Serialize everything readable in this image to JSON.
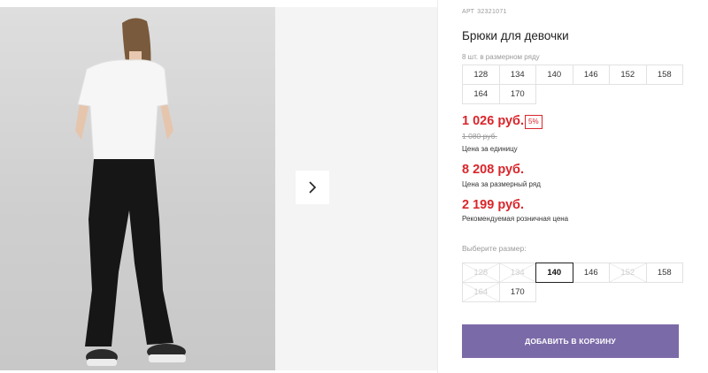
{
  "product": {
    "article_label": "АРТ",
    "article": "32321071",
    "title": "Брюки для девочки",
    "pack_info": "8 шт. в размерном ряду"
  },
  "pack_sizes": [
    "128",
    "134",
    "140",
    "146",
    "152",
    "158",
    "164",
    "170"
  ],
  "prices": {
    "unit_price": "1 026 руб.",
    "discount_badge": "5%",
    "old_price": "1 080 руб.",
    "unit_label": "Цена за единицу",
    "pack_price": "8 208 руб.",
    "pack_label": "Цена за размерный ряд",
    "rrp_price": "2 199 руб.",
    "rrp_label": "Рекомендуемая розничная цена"
  },
  "size_picker": {
    "label": "Выберите размер:",
    "sizes": [
      {
        "value": "128",
        "available": false,
        "selected": false
      },
      {
        "value": "134",
        "available": false,
        "selected": false
      },
      {
        "value": "140",
        "available": true,
        "selected": true
      },
      {
        "value": "146",
        "available": true,
        "selected": false
      },
      {
        "value": "152",
        "available": false,
        "selected": false
      },
      {
        "value": "158",
        "available": true,
        "selected": false
      },
      {
        "value": "164",
        "available": false,
        "selected": false
      },
      {
        "value": "170",
        "available": true,
        "selected": false
      }
    ]
  },
  "cart_button": "ДОБАВИТЬ В КОРЗИНУ",
  "gallery": {
    "next_icon": "chevron-right-icon",
    "photo": "product-photo-girl-back-view"
  },
  "colors": {
    "price_red": "#d9262b",
    "button_purple": "#7b6aa8"
  }
}
